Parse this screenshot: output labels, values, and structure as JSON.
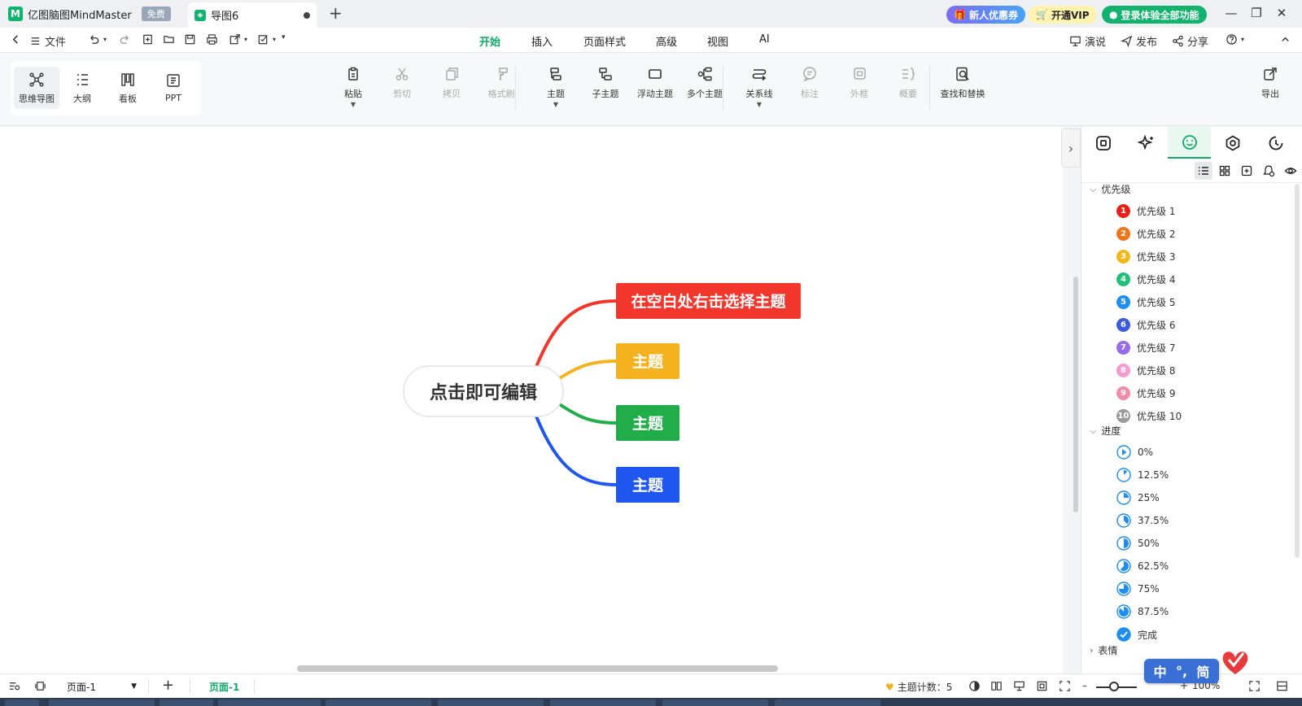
{
  "title_bar": {
    "app_name": "亿图脑图MindMaster",
    "badge": "免费",
    "doc_tab": "导图6",
    "new_tab": "+",
    "promo_coupon": "新人优惠券",
    "promo_vip": "开通VIP",
    "promo_login": "登录体验全部功能"
  },
  "menubar": {
    "file": "文件",
    "tabs": [
      "开始",
      "插入",
      "页面样式",
      "高级",
      "视图",
      "AI"
    ],
    "active_tab": "开始",
    "present": "演说",
    "publish": "发布",
    "share": "分享"
  },
  "ribbon": {
    "views": [
      "思维导图",
      "大纲",
      "看板",
      "PPT"
    ],
    "tools": [
      {
        "label": "粘贴",
        "icon": "paste-icon",
        "enabled": true,
        "caret": true
      },
      {
        "label": "剪切",
        "icon": "cut-icon",
        "enabled": false,
        "caret": false
      },
      {
        "label": "拷贝",
        "icon": "copy-icon",
        "enabled": false,
        "caret": false
      },
      {
        "label": "格式刷",
        "icon": "format-brush-icon",
        "enabled": false,
        "caret": false
      },
      {
        "label": "主题",
        "icon": "topic-icon",
        "enabled": true,
        "caret": true
      },
      {
        "label": "子主题",
        "icon": "subtopic-icon",
        "enabled": true,
        "caret": false
      },
      {
        "label": "浮动主题",
        "icon": "floating-topic-icon",
        "enabled": true,
        "caret": false
      },
      {
        "label": "多个主题",
        "icon": "multiple-topics-icon",
        "enabled": true,
        "caret": false
      },
      {
        "label": "关系线",
        "icon": "relationship-icon",
        "enabled": true,
        "caret": true
      },
      {
        "label": "标注",
        "icon": "callout-icon",
        "enabled": false,
        "caret": false
      },
      {
        "label": "外框",
        "icon": "boundary-icon",
        "enabled": false,
        "caret": false
      },
      {
        "label": "概要",
        "icon": "summary-icon",
        "enabled": false,
        "caret": false
      },
      {
        "label": "查找和替换",
        "icon": "find-replace-icon",
        "enabled": true,
        "caret": false
      }
    ],
    "export": "导出"
  },
  "mindmap": {
    "central": "点击即可编辑",
    "branches": [
      {
        "label": "在空白处右击选择主题",
        "color": "#f2362b"
      },
      {
        "label": "主题",
        "color": "#f5b21f"
      },
      {
        "label": "主题",
        "color": "#20ad4a"
      },
      {
        "label": "主题",
        "color": "#1f56f0"
      }
    ]
  },
  "right_panel": {
    "sections": {
      "priority": "优先级",
      "progress": "进度",
      "emotion": "表情"
    },
    "priorities": [
      {
        "n": "1",
        "label": "优先级 1",
        "color": "#e8221b"
      },
      {
        "n": "2",
        "label": "优先级 2",
        "color": "#f0761c"
      },
      {
        "n": "3",
        "label": "优先级 3",
        "color": "#f5b81b"
      },
      {
        "n": "4",
        "label": "优先级 4",
        "color": "#21c07a"
      },
      {
        "n": "5",
        "label": "优先级 5",
        "color": "#1e8ff0"
      },
      {
        "n": "6",
        "label": "优先级 6",
        "color": "#3b5bdc"
      },
      {
        "n": "7",
        "label": "优先级 7",
        "color": "#9a6be8"
      },
      {
        "n": "8",
        "label": "优先级 8",
        "color": "#f29bd0"
      },
      {
        "n": "9",
        "label": "优先级 9",
        "color": "#f08ca8"
      },
      {
        "n": "10",
        "label": "优先级 10",
        "color": "#9a9a9a"
      }
    ],
    "progress": [
      {
        "label": "0%",
        "fraction": 0
      },
      {
        "label": "12.5%",
        "fraction": 0.125
      },
      {
        "label": "25%",
        "fraction": 0.25
      },
      {
        "label": "37.5%",
        "fraction": 0.375
      },
      {
        "label": "50%",
        "fraction": 0.5
      },
      {
        "label": "62.5%",
        "fraction": 0.625
      },
      {
        "label": "75%",
        "fraction": 0.75
      },
      {
        "label": "87.5%",
        "fraction": 0.875
      },
      {
        "label": "完成",
        "fraction": 1
      }
    ]
  },
  "statusbar": {
    "page_select": "页面-1",
    "add_page": "+",
    "active_page": "页面-1",
    "topic_count": "主题计数：5",
    "zoom": "100%"
  },
  "ime": {
    "mode": "中",
    "punct": "°,",
    "script": "简"
  },
  "colors": {
    "accent": "#11a86a",
    "title_bar_bg": "#eef0f3"
  }
}
